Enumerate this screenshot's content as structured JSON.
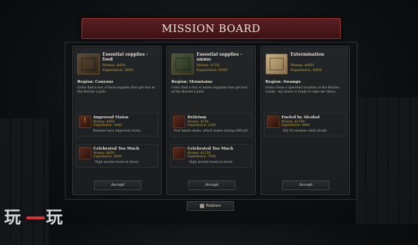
{
  "board": {
    "title": "MISSION BOARD"
  },
  "cards": [
    {
      "title": "Essential supplies - food",
      "money_label": "Money:",
      "money": "$450",
      "exp_label": "Experience:",
      "exp": "3600",
      "region": "Region: Canyons",
      "description": "Gotta find a box of food supplies that get lost at the Barren Lands.",
      "thumb": "food-crate-icon",
      "modifiers": [
        {
          "name": "Improved Vision",
          "money": "Money: $450",
          "exp": "Experience: 2400",
          "desc": "Enemies have improved vision.",
          "icon": "!"
        },
        {
          "name": "Celebrated Too Much",
          "money": "Money: $650",
          "exp": "Experience: 4000",
          "desc": "High alcohol levels in blood.",
          "icon": "bottles"
        }
      ],
      "accept_label": "Accept"
    },
    {
      "title": "Essential supplies - ammo",
      "money_label": "Money:",
      "money": "$750",
      "exp_label": "Experience:",
      "exp": "6300",
      "region": "Region: Mountains",
      "description": "Gotta find a box of ammo supplies that get lost at the Barren Lands.",
      "thumb": "ammo-crate-icon",
      "modifiers": [
        {
          "name": "Delirium",
          "money": "Money: $750",
          "exp": "Experience: 2300",
          "desc": "Your hands shake, which makes aiming difficult.",
          "icon": "shaking-hand"
        },
        {
          "name": "Celebrated Too Much",
          "money": "Money: $1250",
          "exp": "Experience: 7000",
          "desc": "High alcohol levels in blood.",
          "icon": "bottles"
        }
      ],
      "accept_label": "Accept"
    },
    {
      "title": "Extermination",
      "money_label": "Money:",
      "money": "$950",
      "exp_label": "Experience:",
      "exp": "4400",
      "region": "Region: Swamps",
      "description": "Gotta clean a specified location at the Barren Lands - my horse is ready to take me there.",
      "thumb": "map-icon",
      "modifiers": [
        {
          "name": "Fueled by Alcohol",
          "money": "Money: $1190",
          "exp": "Experience: 4400",
          "desc": "Kill 20 enemies while drunk.",
          "icon": "drunk-portrait"
        }
      ],
      "accept_label": "Accept"
    }
  ],
  "redraw_label": "Redraw",
  "watermark": {
    "left": "玩",
    "right": "玩"
  },
  "colors": {
    "header": "#5a1f22",
    "gold": "#d2a73c"
  }
}
